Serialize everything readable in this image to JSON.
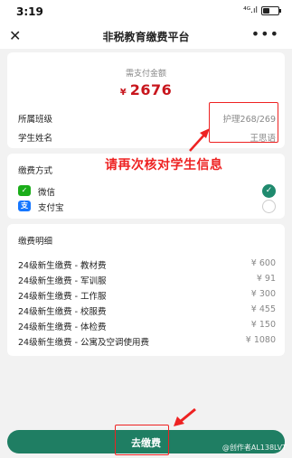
{
  "status_bar": {
    "time": "3:19",
    "signal": "⁴ᴳ.ıl",
    "battery_level": 0.45
  },
  "nav": {
    "close_icon": "close-icon",
    "title": "非税教育缴费平台",
    "more_icon": "more-icon"
  },
  "amount_card": {
    "label": "需支付金额",
    "currency": "¥",
    "value": "2676",
    "class_label": "所属班级",
    "class_value": "护理268/269",
    "student_label": "学生姓名",
    "student_value": "王思语"
  },
  "annotation": {
    "hint": "请再次核对学生信息",
    "color": "#ee2222"
  },
  "payment_method": {
    "title": "缴费方式",
    "options": [
      {
        "label": "微信",
        "icon": "wechat-icon",
        "selected": true
      },
      {
        "label": "支付宝",
        "icon": "alipay-icon",
        "selected": false
      }
    ]
  },
  "details": {
    "title": "缴费明细",
    "items": [
      {
        "name": "24级新生缴费 - 教材费",
        "price": "¥  600"
      },
      {
        "name": "24级新生缴费 - 军训服",
        "price": "¥   91"
      },
      {
        "name": "24级新生缴费 - 工作服",
        "price": "¥  300"
      },
      {
        "name": "24级新生缴费 - 校服费",
        "price": "¥  455"
      },
      {
        "name": "24级新生缴费 - 体检费",
        "price": "¥  150"
      },
      {
        "name": "24级新生缴费 - 公寓及空调使用费",
        "price": "¥  1080"
      }
    ]
  },
  "pay_button": {
    "label": "去缴费",
    "color": "#1f7e63"
  },
  "watermark": "@创作者AL138LVT"
}
